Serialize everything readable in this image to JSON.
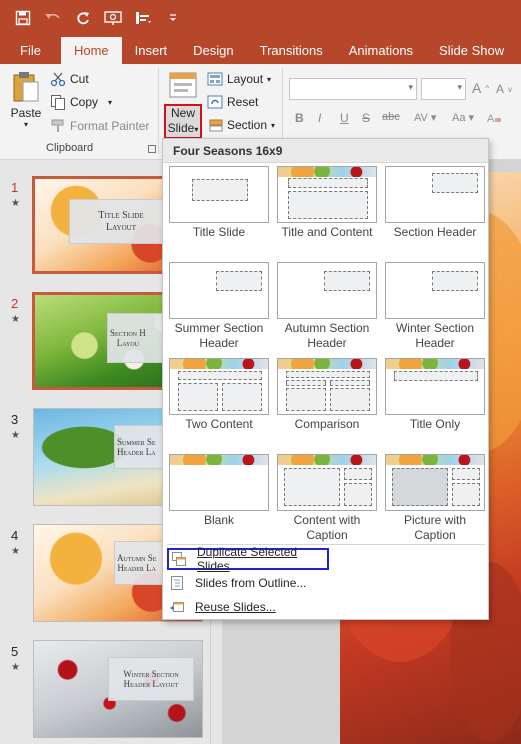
{
  "quick_access": {
    "icons": [
      "save-icon",
      "undo-icon",
      "redo-icon",
      "slideshow-from-start-icon",
      "touch-mode-icon",
      "customize-qat-icon"
    ]
  },
  "tabs": [
    "File",
    "Home",
    "Insert",
    "Design",
    "Transitions",
    "Animations",
    "Slide Show"
  ],
  "active_tab": "Home",
  "ribbon": {
    "paste_label": "Paste",
    "cut_label": "Cut",
    "copy_label": "Copy",
    "format_painter_label": "Format Painter",
    "clipboard_group_label": "Clipboard",
    "new_slide_line1": "New",
    "new_slide_line2": "Slide",
    "layout_label": "Layout",
    "reset_label": "Reset",
    "section_label": "Section",
    "font_buttons": [
      "B",
      "I",
      "U",
      "S",
      "abc"
    ],
    "grow_font": "A",
    "shrink_font": "A",
    "colors": {
      "highlight_outline": "#d0121b",
      "accent": "#b7472a"
    }
  },
  "gallery": {
    "header": "Four Seasons 16x9",
    "layouts": [
      {
        "label": "Title Slide"
      },
      {
        "label": "Title and Content"
      },
      {
        "label": "Section Header"
      },
      {
        "label": "Summer Section\nHeader"
      },
      {
        "label": "Autumn Section\nHeader"
      },
      {
        "label": "Winter Section\nHeader"
      },
      {
        "label": "Two Content"
      },
      {
        "label": "Comparison"
      },
      {
        "label": "Title Only"
      },
      {
        "label": "Blank"
      },
      {
        "label": "Content with\nCaption"
      },
      {
        "label": "Picture with\nCaption"
      }
    ],
    "menu": [
      {
        "label": "Duplicate Selected Slides",
        "icon": "duplicate-slide-icon"
      },
      {
        "label": "Slides from Outline...",
        "icon": "outline-icon"
      },
      {
        "label": "Reuse Slides...",
        "icon": "reuse-slides-icon"
      }
    ],
    "outline_color": "#1f27c9"
  },
  "slides": [
    {
      "number": "1",
      "title": "Title Slide\nLayout",
      "selected": true
    },
    {
      "number": "2",
      "title": "Section H\nLayou",
      "selected": true
    },
    {
      "number": "3",
      "title": "Summer Se\nHeader La",
      "selected": false
    },
    {
      "number": "4",
      "title": "Autumn Se\nHeader La",
      "selected": false
    },
    {
      "number": "5",
      "title": "Winter Section\nHeader Layout",
      "selected": false
    }
  ],
  "slide_marker": "★"
}
